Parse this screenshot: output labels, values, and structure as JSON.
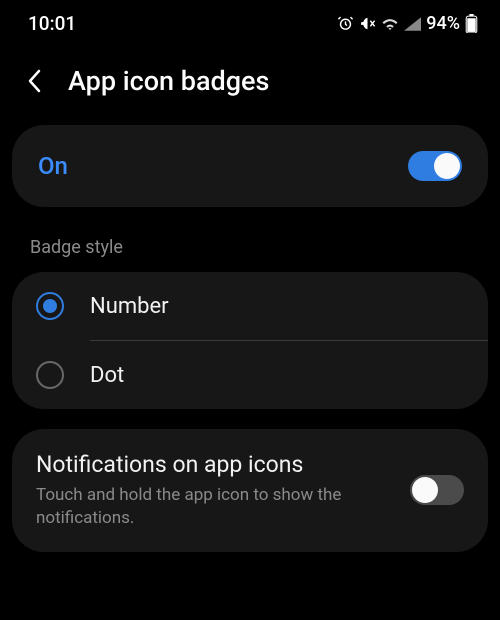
{
  "status": {
    "time": "10:01",
    "battery_pct": "94%",
    "icons": [
      "alarm",
      "mute",
      "wifi",
      "signal",
      "battery"
    ]
  },
  "header": {
    "title": "App icon badges"
  },
  "master": {
    "label": "On",
    "enabled": true
  },
  "section_label": "Badge style",
  "badge_options": [
    {
      "label": "Number",
      "selected": true
    },
    {
      "label": "Dot",
      "selected": false
    }
  ],
  "notif_on_icons": {
    "title": "Notifications on app icons",
    "subtitle": "Touch and hold the app icon to show the notifications.",
    "enabled": false
  },
  "colors": {
    "accent": "#2f7de0",
    "accent_text": "#3b8cff"
  }
}
